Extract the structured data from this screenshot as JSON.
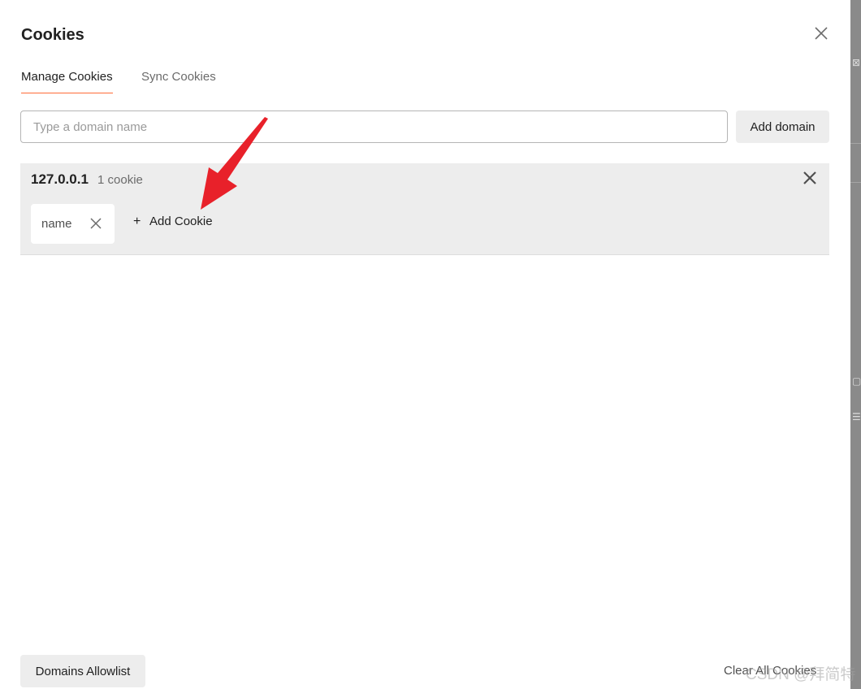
{
  "dialog": {
    "title": "Cookies",
    "close_icon": "close-icon"
  },
  "tabs": [
    {
      "label": "Manage Cookies",
      "active": true
    },
    {
      "label": "Sync Cookies",
      "active": false
    }
  ],
  "domain_input": {
    "value": "",
    "placeholder": "Type a domain name"
  },
  "add_domain_label": "Add domain",
  "domains": [
    {
      "name": "127.0.0.1",
      "count_label": "1 cookie",
      "cookies": [
        {
          "name": "name"
        }
      ],
      "add_cookie_label": "Add Cookie"
    }
  ],
  "footer": {
    "allowlist_label": "Domains Allowlist",
    "clear_all_label": "Clear All Cookies"
  },
  "watermark": "CSDN @拜简特",
  "colors": {
    "accent": "#ff6c37",
    "annotation_arrow": "#e8212a",
    "card_bg": "#ededed"
  }
}
